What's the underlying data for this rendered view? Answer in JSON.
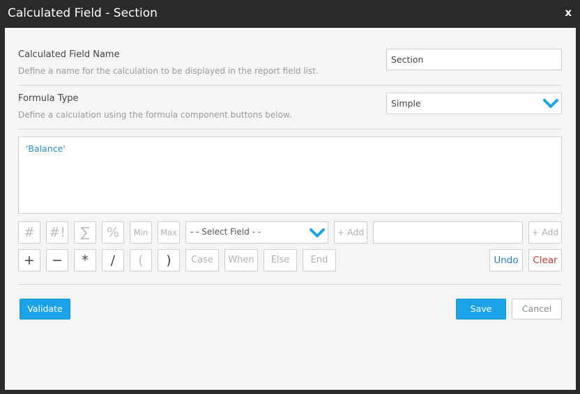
{
  "dialog": {
    "title": "Calculated Field - Section",
    "close_label": "x"
  },
  "name_section": {
    "label": "Calculated Field Name",
    "description": "Define a name for the calculation to be displayed in the report field list.",
    "value": "Section"
  },
  "formula_type": {
    "label": "Formula Type",
    "description": "Define a calculation using the formula component buttons below.",
    "selected": "Simple"
  },
  "formula": {
    "text": "'Balance'"
  },
  "toolbar_row1": {
    "hash": "#",
    "hash_bang": "#!",
    "sigma": "∑",
    "percent": "%",
    "min": "Min",
    "max": "Max",
    "field_select": "- - Select Field - -",
    "add1": "+ Add",
    "add2": "+ Add"
  },
  "toolbar_row2": {
    "plus": "+",
    "minus": "−",
    "times": "*",
    "divide": "/",
    "lparen": "(",
    "rparen": ")",
    "case": "Case",
    "when": "When",
    "else": "Else",
    "end": "End",
    "undo": "Undo",
    "clear": "Clear"
  },
  "footer": {
    "validate": "Validate",
    "save": "Save",
    "cancel": "Cancel"
  },
  "colors": {
    "accent": "#1aa3e6",
    "clear": "#c0392b",
    "undo": "#2a7bb5"
  }
}
